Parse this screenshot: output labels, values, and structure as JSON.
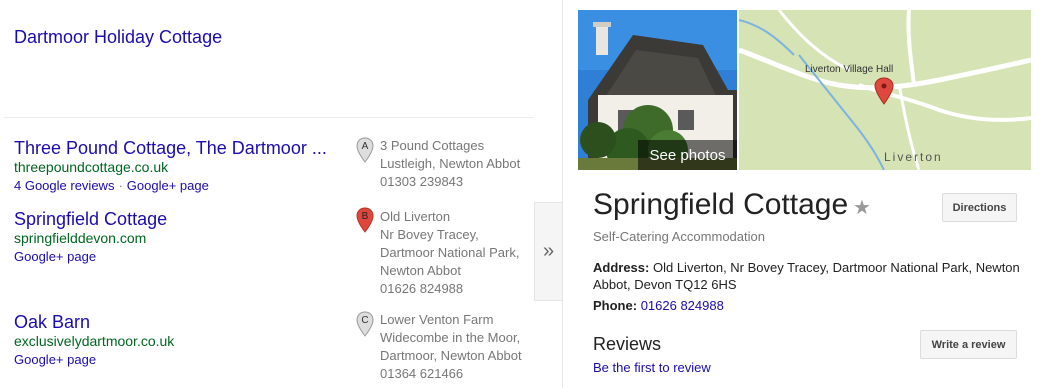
{
  "top_result": {
    "title": "Dartmoor Holiday Cottage"
  },
  "results": [
    {
      "title": "Three Pound Cottage, The Dartmoor ...",
      "url": "threepoundcottage.co.uk",
      "links": [
        "4 Google reviews",
        "Google+ page"
      ],
      "pin_letter": "A",
      "address_lines": [
        "3 Pound Cottages",
        "Lustleigh, Newton Abbot",
        "01303 239843"
      ]
    },
    {
      "title": "Springfield Cottage",
      "url": "springfielddevon.com",
      "links": [
        "Google+ page"
      ],
      "pin_letter": "B",
      "address_lines": [
        "Old Liverton",
        "Nr Bovey Tracey,",
        "Dartmoor National Park,",
        "Newton Abbot",
        "01626 824988"
      ]
    },
    {
      "title": "Oak Barn",
      "url": "exclusivelydartmoor.co.uk",
      "links": [
        "Google+ page"
      ],
      "pin_letter": "C",
      "address_lines": [
        "Lower Venton Farm",
        "Widecombe in the Moor,",
        "Dartmoor, Newton Abbot",
        "01364 621466"
      ]
    }
  ],
  "expander": {
    "icon": "double-chevron-right-icon",
    "glyph": "»"
  },
  "panel": {
    "see_photos": "See photos",
    "map": {
      "hall_label": "Liverton Village Hall",
      "town_label": "Liverton"
    },
    "title": "Springfield Cottage",
    "star_glyph": "★",
    "directions": "Directions",
    "category": "Self-Catering Accommodation",
    "address_label": "Address:",
    "address_value": "Old Liverton, Nr Bovey Tracey, Dartmoor National Park, Newton Abbot, Devon TQ12 6HS",
    "phone_label": "Phone:",
    "phone_value": "01626 824988",
    "reviews_heading": "Reviews",
    "write_review": "Write a review",
    "first_review": "Be the first to review"
  },
  "colors": {
    "link": "#1a0dab",
    "url_green": "#006621",
    "pin_active": "#e0473c",
    "pin_inactive": "#dddddd"
  }
}
